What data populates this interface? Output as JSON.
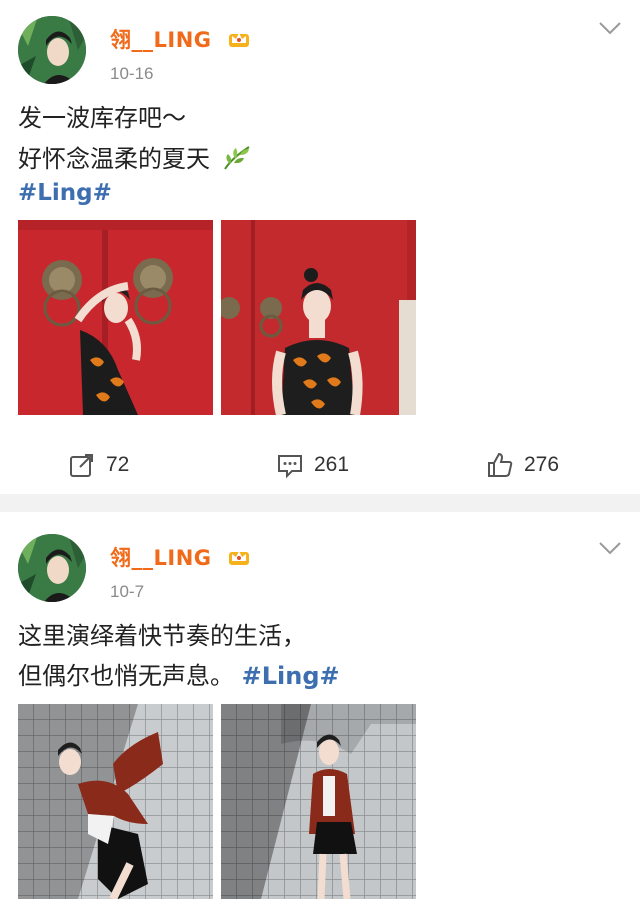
{
  "posts": [
    {
      "username": "翎__LING",
      "time": "10-16",
      "text_lines": [
        "发一波库存吧～",
        "好怀念温柔的夏天"
      ],
      "hashtag": "#Ling#",
      "emoji_icon": "leaf-emoji-icon",
      "photos": [
        "photo-red-door-pose",
        "photo-red-door-standing"
      ],
      "actions": {
        "repost": "72",
        "comment": "261",
        "like": "276"
      }
    },
    {
      "username": "翎__LING",
      "time": "10-7",
      "text_lines": [
        "这里演绎着快节奏的生活，",
        "但偶尔也悄无声息。"
      ],
      "hashtag": "#Ling#",
      "photos": [
        "photo-tile-wall-dance",
        "photo-tile-wall-standing"
      ]
    }
  ],
  "colors": {
    "username": "#f06a1a",
    "hashtag": "#3d6fb0",
    "time": "#8a8a8a",
    "separator": "#f2f2f2"
  }
}
